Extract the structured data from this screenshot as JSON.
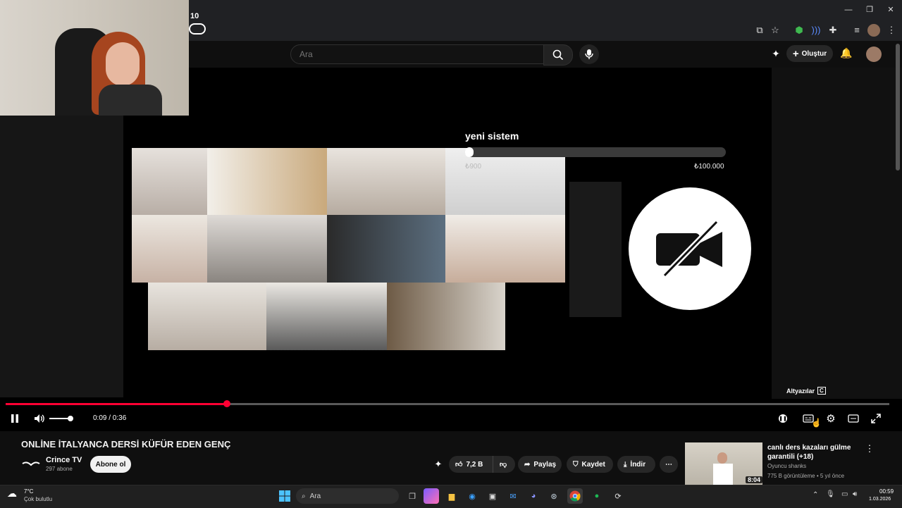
{
  "browser": {
    "tab_badge": "10",
    "colors": {
      "frame": "#202124",
      "accent": "#ff0033"
    }
  },
  "youtube_header": {
    "search_placeholder": "Ara",
    "create_label": "Oluştur"
  },
  "video_overlay": {
    "title": "yeni sistem",
    "goal_current": "₺900",
    "goal_max": "₺100.000",
    "goal_progress_fraction": 0.009
  },
  "player": {
    "time": "0:09 / 0:36",
    "progress_fraction": 0.25,
    "tooltip_label": "Altyazılar",
    "tooltip_key": "C"
  },
  "video_info": {
    "title": "ONLİNE İTALYANCA DERSİ KÜFÜR EDEN GENÇ",
    "channel_name": "Crince TV",
    "subscribers": "297 abone",
    "subscribe_label": "Abone ol",
    "likes": "7,2 B",
    "share_label": "Paylaş",
    "save_label": "Kaydet",
    "download_label": "İndir"
  },
  "recommendation": {
    "title": "canlı ders kazaları gülme garantili (+18)",
    "channel": "Oyuncu shanks",
    "meta": "775 B görüntüleme • 5 yıl önce",
    "duration": "8:04"
  },
  "taskbar": {
    "temperature": "7°C",
    "weather": "Çok bulutlu",
    "search_label": "Ara",
    "time": "00:59",
    "date": "1.03.2026"
  }
}
